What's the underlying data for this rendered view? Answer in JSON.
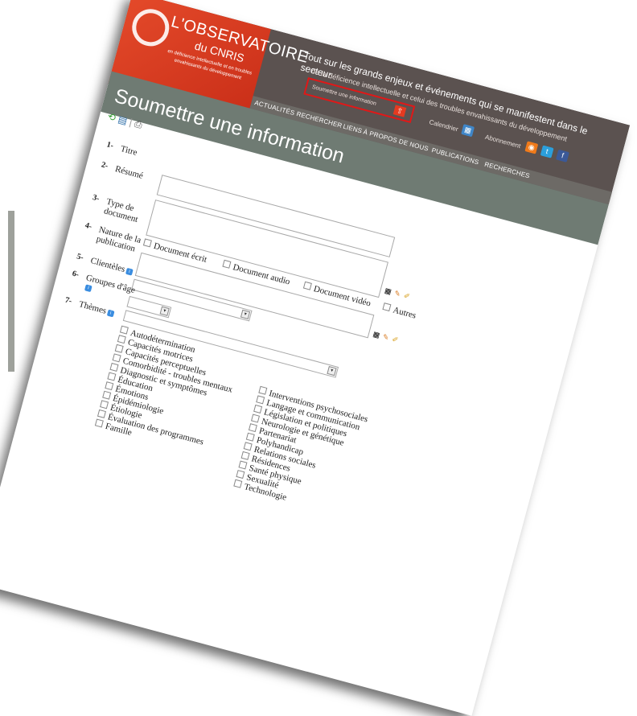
{
  "logo": {
    "title": "L'OBSERVATOIRE",
    "subtitle": "du CNRIS",
    "tagline": "en déficience intellectuelle et en troubles envahissants du développement"
  },
  "header": {
    "tagline_main": "Tout sur les grands enjeux et événements qui se manifestent dans le secteur",
    "tagline_sub": "de la déficience intellectuelle et celui des troubles envahissants du développement",
    "submit_label": "Soumettre une information",
    "calendar_label": "Calendrier",
    "subscribe_label": "Abonnement"
  },
  "nav": [
    "ACTUALITÉS",
    "RECHERCHER",
    "LIENS",
    "À PROPOS DE NOUS",
    "PUBLICATIONS",
    "RECHERCHES"
  ],
  "page": {
    "title": "Soumettre une information"
  },
  "form": {
    "fields": [
      {
        "num": "1-",
        "label": "Titre"
      },
      {
        "num": "2-",
        "label": "Résumé"
      },
      {
        "num": "3-",
        "label": "Type de document"
      },
      {
        "num": "4-",
        "label": "Nature de la publication"
      },
      {
        "num": "5-",
        "label": "Clientèles"
      },
      {
        "num": "6-",
        "label": "Groupes d'âge"
      },
      {
        "num": "7-",
        "label": "Thèmes"
      }
    ],
    "doc_types": [
      "Document écrit",
      "Document audio",
      "Document vidéo",
      "Autres"
    ],
    "themes_left": [
      "Autodétermination",
      "Capacités motrices",
      "Capacités perceptuelles",
      "Comorbidité - troubles mentaux",
      "Diagnostic et symptômes",
      "Éducation",
      "Émotions",
      "Épidémiologie",
      "Étiologie",
      "Évaluation des programmes",
      "Famille"
    ],
    "themes_right": [
      "Interventions psychosociales",
      "Langage et communication",
      "Législation et politiques",
      "Neurologie et génétique",
      "Partenariat",
      "Polyhandicap",
      "Relations sociales",
      "Résidences",
      "Santé physique",
      "Sexualité",
      "Technologie"
    ]
  },
  "colors": {
    "brand": "#e44a2a",
    "header": "#5b5250",
    "titlebar": "#6f7b73",
    "highlight": "#e01818"
  }
}
